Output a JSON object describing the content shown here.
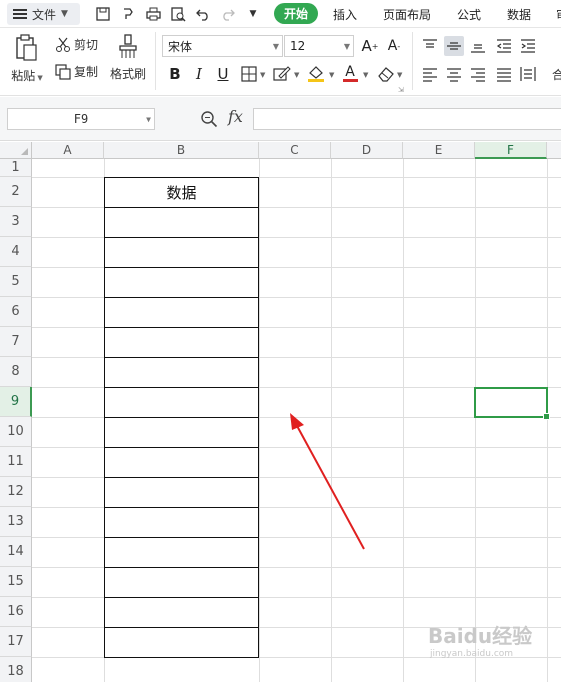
{
  "menubar": {
    "file_label": "文件",
    "start_tab": "开始",
    "tabs": [
      "插入",
      "页面布局",
      "公式",
      "数据",
      "审"
    ]
  },
  "ribbon": {
    "paste_label": "粘贴",
    "cut_label": "剪切",
    "copy_label": "复制",
    "format_painter_label": "格式刷",
    "font_name": "宋体",
    "font_size": "12",
    "bold": "B",
    "italic": "I",
    "underline": "U",
    "font_color_glyph": "A",
    "font_color": "#d42a2a",
    "fill_color": "#f5c518",
    "wrap_label": "合"
  },
  "formula_bar": {
    "cell_ref": "F9",
    "fx_label": "fx",
    "formula_value": ""
  },
  "sheet": {
    "columns": [
      "A",
      "B",
      "C",
      "D",
      "E",
      "F"
    ],
    "rows": [
      "1",
      "2",
      "3",
      "4",
      "5",
      "6",
      "7",
      "8",
      "9",
      "10",
      "11",
      "12",
      "13",
      "14",
      "15",
      "16",
      "17",
      "18"
    ],
    "selected_column": "F",
    "selected_row": "9",
    "header_cell_text": "数据",
    "accent_color": "#2f9b47"
  },
  "watermark": {
    "text": "Baidu经验",
    "sub": "jingyan.baidu.com"
  }
}
